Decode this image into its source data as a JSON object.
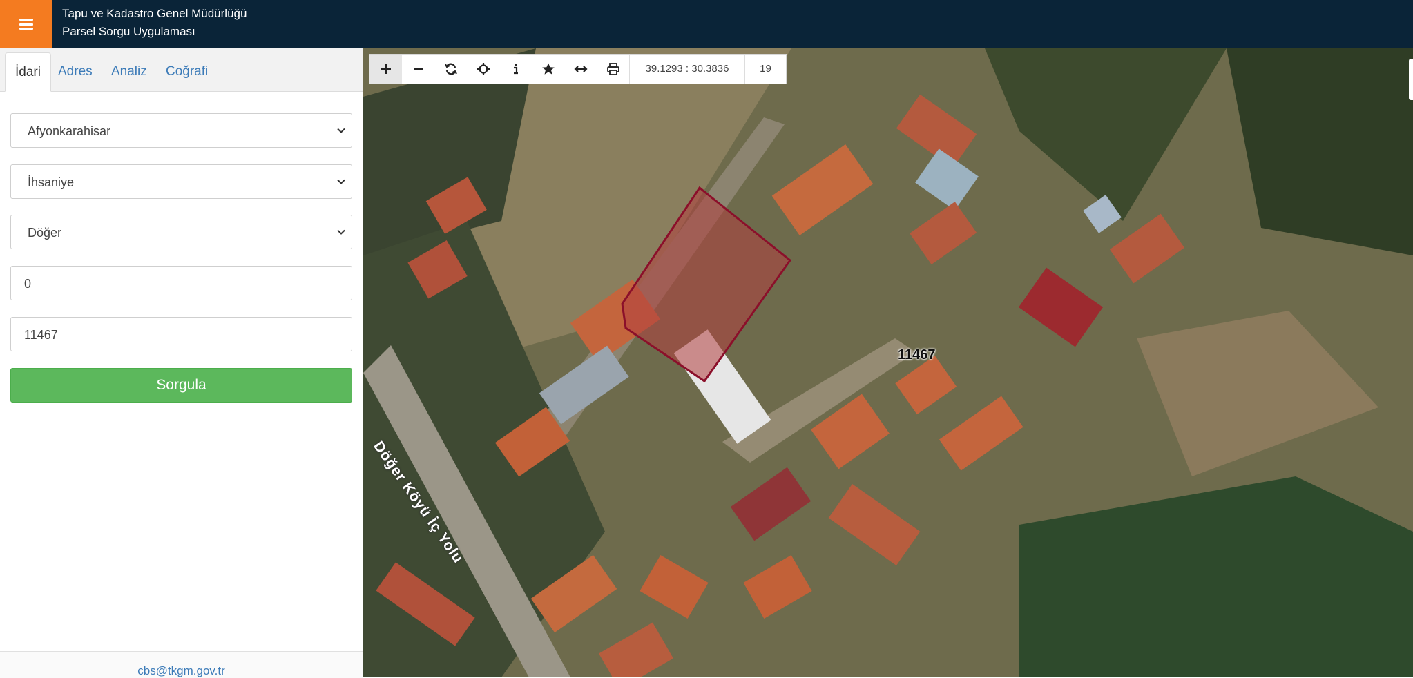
{
  "header": {
    "line1": "Tapu ve Kadastro Genel Müdürlüğü",
    "line2": "Parsel Sorgu Uygulaması",
    "bg_color": "#0a2438",
    "menu_color": "#f47b20",
    "menu_icon": "hamburger-icon"
  },
  "tabs": [
    {
      "label": "İdari",
      "active": true
    },
    {
      "label": "Adres",
      "active": false
    },
    {
      "label": "Analiz",
      "active": false
    },
    {
      "label": "Coğrafi",
      "active": false
    }
  ],
  "form": {
    "il": "Afyonkarahisar",
    "ilce": "İhsaniye",
    "mahalle": "Döğer",
    "ada": "0",
    "parsel": "11467",
    "submit_label": "Sorgula",
    "submit_color": "#5cb85c"
  },
  "footer": {
    "email": "cbs@tkgm.gov.tr"
  },
  "map_toolbar": {
    "buttons": [
      "plus-icon",
      "minus-icon",
      "refresh-icon",
      "crosshair-icon",
      "info-icon",
      "star-icon",
      "measure-icon",
      "print-icon"
    ],
    "coordinates": "39.1293 : 30.3836",
    "zoom": "19"
  },
  "map": {
    "parcel_label": "11467",
    "road_label": "Döğer Köyü İç Yolu",
    "parcel_color": "#8b0f2a"
  }
}
